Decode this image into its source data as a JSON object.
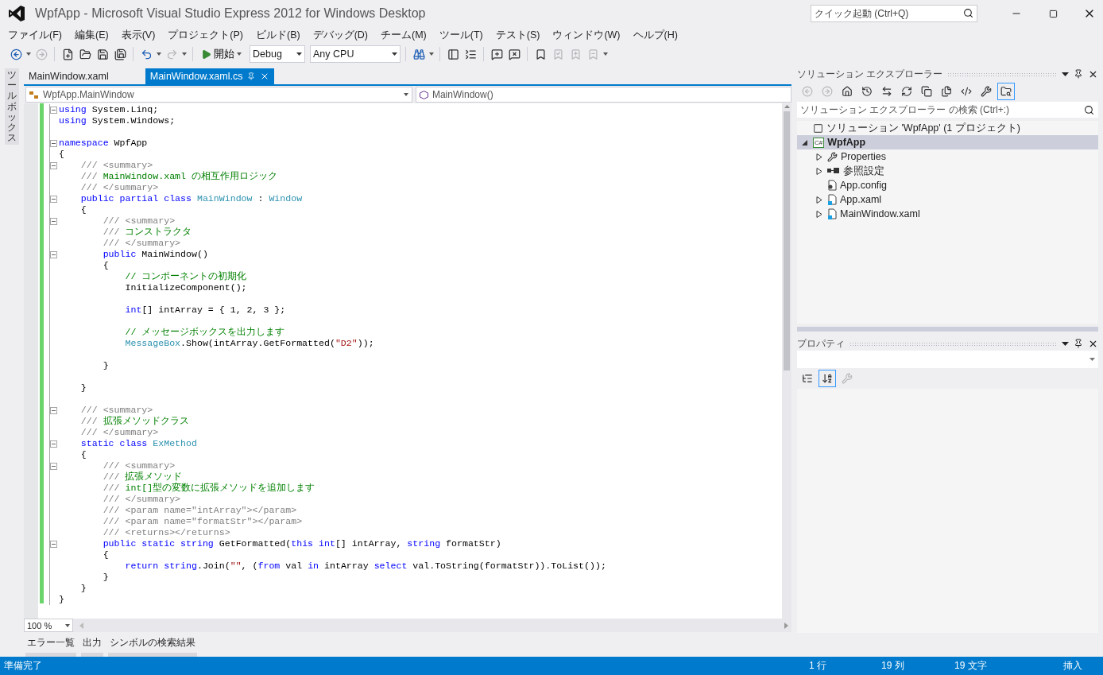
{
  "window": {
    "title": "WpfApp - Microsoft Visual Studio Express 2012 for Windows Desktop",
    "quick_launch": {
      "placeholder": "クイック起動 (Ctrl+Q)"
    }
  },
  "menu": [
    "ファイル(F)",
    "編集(E)",
    "表示(V)",
    "プロジェクト(P)",
    "ビルド(B)",
    "デバッグ(D)",
    "チーム(M)",
    "ツール(T)",
    "テスト(S)",
    "ウィンドウ(W)",
    "ヘルプ(H)"
  ],
  "toolbar": [
    {
      "kind": "icon",
      "disabled": false
    },
    {
      "kind": "caret"
    },
    {
      "kind": "icon",
      "disabled": true
    },
    {
      "kind": "separator"
    },
    {
      "kind": "icon",
      "disabled": false
    },
    {
      "kind": "icon",
      "disabled": false
    },
    {
      "kind": "icon",
      "disabled": false
    },
    {
      "kind": "icon",
      "disabled": false
    },
    {
      "kind": "separator"
    },
    {
      "kind": "icon",
      "disabled": false
    },
    {
      "kind": "caret"
    },
    {
      "kind": "icon",
      "disabled": true
    },
    {
      "kind": "caret"
    },
    {
      "kind": "separator"
    },
    {
      "kind": "button",
      "label": "開始"
    },
    {
      "kind": "dropdown",
      "value": "Debug"
    },
    {
      "kind": "dropdown",
      "value": "Any CPU"
    },
    {
      "kind": "separator"
    },
    {
      "kind": "icon",
      "disabled": false
    },
    {
      "kind": "caret"
    },
    {
      "kind": "separator"
    },
    {
      "kind": "icon",
      "disabled": false
    },
    {
      "kind": "icon",
      "disabled": false
    },
    {
      "kind": "separator"
    },
    {
      "kind": "icon",
      "disabled": false
    },
    {
      "kind": "icon",
      "disabled": false
    },
    {
      "kind": "separator"
    },
    {
      "kind": "icon",
      "disabled": false
    },
    {
      "kind": "icon",
      "disabled": true
    },
    {
      "kind": "icon",
      "disabled": true
    },
    {
      "kind": "icon",
      "disabled": true
    },
    {
      "kind": "caret"
    }
  ],
  "side_tab": "ツールボックス",
  "editor": {
    "tabs": [
      {
        "label": "MainWindow.xaml",
        "selected": false
      },
      {
        "label": "MainWindow.xaml.cs",
        "selected": true
      }
    ],
    "nav": {
      "type": "WpfApp.MainWindow",
      "member": "MainWindow()"
    },
    "lines": [
      {
        "fold": true,
        "tokens": [
          {
            "kind": "kw",
            "text": "using"
          },
          {
            "kind": "plain",
            "text": " System.Linq;"
          }
        ]
      },
      {
        "fold": false,
        "tokens": [
          {
            "kind": "kw",
            "text": "using"
          },
          {
            "kind": "plain",
            "text": " System.Windows;"
          }
        ]
      },
      {
        "fold": false
      },
      {
        "fold": true,
        "tokens": [
          {
            "kind": "kw",
            "text": "namespace"
          },
          {
            "kind": "plain",
            "text": " WpfApp"
          }
        ]
      },
      {
        "fold": false,
        "tokens": [
          {
            "kind": "plain",
            "text": "{"
          }
        ]
      },
      {
        "fold": true,
        "tokens": [
          {
            "kind": "doc",
            "text": "    /// <summary>"
          }
        ]
      },
      {
        "fold": false,
        "tokens": [
          {
            "kind": "doc",
            "text": "    ///"
          },
          {
            "kind": "comment",
            "text": " MainWindow.xaml の相互作用ロジック"
          }
        ]
      },
      {
        "fold": false,
        "tokens": [
          {
            "kind": "doc",
            "text": "    /// </summary>"
          }
        ]
      },
      {
        "fold": true,
        "tokens": [
          {
            "kind": "kw",
            "text": "    public partial class"
          },
          {
            "kind": "type",
            "text": " MainWindow"
          },
          {
            "kind": "plain",
            "text": " : "
          },
          {
            "kind": "type",
            "text": "Window"
          }
        ]
      },
      {
        "fold": false,
        "tokens": [
          {
            "kind": "plain",
            "text": "    {"
          }
        ]
      },
      {
        "fold": true,
        "tokens": [
          {
            "kind": "doc",
            "text": "        /// <summary>"
          }
        ]
      },
      {
        "fold": false,
        "tokens": [
          {
            "kind": "doc",
            "text": "        ///"
          },
          {
            "kind": "comment",
            "text": " コンストラクタ"
          }
        ]
      },
      {
        "fold": false,
        "tokens": [
          {
            "kind": "doc",
            "text": "        /// </summary>"
          }
        ]
      },
      {
        "fold": true,
        "tokens": [
          {
            "kind": "kw",
            "text": "        public"
          },
          {
            "kind": "plain",
            "text": " MainWindow()"
          }
        ]
      },
      {
        "fold": false,
        "tokens": [
          {
            "kind": "plain",
            "text": "        {"
          }
        ]
      },
      {
        "fold": false,
        "tokens": [
          {
            "kind": "comment",
            "text": "            // コンポーネントの初期化"
          }
        ]
      },
      {
        "fold": false,
        "tokens": [
          {
            "kind": "plain",
            "text": "            InitializeComponent();"
          }
        ]
      },
      {
        "fold": false
      },
      {
        "fold": false,
        "tokens": [
          {
            "kind": "kw",
            "text": "            int"
          },
          {
            "kind": "plain",
            "text": "[] intArray = { 1, 2, 3 };"
          }
        ]
      },
      {
        "fold": false
      },
      {
        "fold": false,
        "tokens": [
          {
            "kind": "comment",
            "text": "            // メッセージボックスを出力します"
          }
        ]
      },
      {
        "fold": false,
        "tokens": [
          {
            "kind": "type",
            "text": "            MessageBox"
          },
          {
            "kind": "plain",
            "text": ".Show(intArray.GetFormatted("
          },
          {
            "kind": "str",
            "text": "\"D2\""
          },
          {
            "kind": "plain",
            "text": "));"
          }
        ]
      },
      {
        "fold": false
      },
      {
        "fold": false,
        "tokens": [
          {
            "kind": "plain",
            "text": "        }"
          }
        ]
      },
      {
        "fold": false
      },
      {
        "fold": false,
        "tokens": [
          {
            "kind": "plain",
            "text": "    }"
          }
        ]
      },
      {
        "fold": false
      },
      {
        "fold": true,
        "tokens": [
          {
            "kind": "doc",
            "text": "    /// <summary>"
          }
        ]
      },
      {
        "fold": false,
        "tokens": [
          {
            "kind": "doc",
            "text": "    ///"
          },
          {
            "kind": "comment",
            "text": " 拡張メソッドクラス"
          }
        ]
      },
      {
        "fold": false,
        "tokens": [
          {
            "kind": "doc",
            "text": "    /// </summary>"
          }
        ]
      },
      {
        "fold": true,
        "tokens": [
          {
            "kind": "kw",
            "text": "    static class"
          },
          {
            "kind": "type",
            "text": " ExMethod"
          }
        ]
      },
      {
        "fold": false,
        "tokens": [
          {
            "kind": "plain",
            "text": "    {"
          }
        ]
      },
      {
        "fold": true,
        "tokens": [
          {
            "kind": "doc",
            "text": "        /// <summary>"
          }
        ]
      },
      {
        "fold": false,
        "tokens": [
          {
            "kind": "doc",
            "text": "        ///"
          },
          {
            "kind": "comment",
            "text": " 拡張メソッド"
          }
        ]
      },
      {
        "fold": false,
        "tokens": [
          {
            "kind": "doc",
            "text": "        ///"
          },
          {
            "kind": "comment",
            "text": " int[]型の変数に拡張メソッドを追加します"
          }
        ]
      },
      {
        "fold": false,
        "tokens": [
          {
            "kind": "doc",
            "text": "        /// </summary>"
          }
        ]
      },
      {
        "fold": false,
        "tokens": [
          {
            "kind": "doc",
            "text": "        /// <param name=\"intArray\"></param>"
          }
        ]
      },
      {
        "fold": false,
        "tokens": [
          {
            "kind": "doc",
            "text": "        /// <param name=\"formatStr\"></param>"
          }
        ]
      },
      {
        "fold": false,
        "tokens": [
          {
            "kind": "doc",
            "text": "        /// <returns></returns>"
          }
        ]
      },
      {
        "fold": true,
        "tokens": [
          {
            "kind": "kw",
            "text": "        public static string"
          },
          {
            "kind": "plain",
            "text": " GetFormatted("
          },
          {
            "kind": "kw",
            "text": "this int"
          },
          {
            "kind": "plain",
            "text": "[] intArray, "
          },
          {
            "kind": "kw",
            "text": "string"
          },
          {
            "kind": "plain",
            "text": " formatStr)"
          }
        ]
      },
      {
        "fold": false,
        "tokens": [
          {
            "kind": "plain",
            "text": "        {"
          }
        ]
      },
      {
        "fold": false,
        "tokens": [
          {
            "kind": "kw",
            "text": "            return string"
          },
          {
            "kind": "plain",
            "text": ".Join("
          },
          {
            "kind": "str",
            "text": "\"\""
          },
          {
            "kind": "plain",
            "text": ", ("
          },
          {
            "kind": "kw",
            "text": "from"
          },
          {
            "kind": "plain",
            "text": " val "
          },
          {
            "kind": "kw",
            "text": "in"
          },
          {
            "kind": "plain",
            "text": " intArray "
          },
          {
            "kind": "kw",
            "text": "select"
          },
          {
            "kind": "plain",
            "text": " val.ToString(formatStr)).ToList());"
          }
        ]
      },
      {
        "fold": false,
        "tokens": [
          {
            "kind": "plain",
            "text": "        }"
          }
        ]
      },
      {
        "fold": false,
        "tokens": [
          {
            "kind": "plain",
            "text": "    }"
          }
        ]
      },
      {
        "fold": false,
        "tokens": [
          {
            "kind": "plain",
            "text": "}"
          }
        ]
      }
    ],
    "zoom": "100 %"
  },
  "bottom_tabs": [
    "エラー一覧",
    "出力",
    "シンボルの検索結果"
  ],
  "solution_explorer": {
    "title": "ソリューション エクスプローラー",
    "toolbar": [
      {
        "selected": false,
        "disabled": true
      },
      {
        "selected": false,
        "disabled": true
      },
      {
        "selected": false,
        "disabled": false
      },
      {
        "selected": false,
        "disabled": false
      },
      {
        "selected": false,
        "disabled": false
      },
      {
        "selected": false,
        "disabled": false
      },
      {
        "selected": false,
        "disabled": false
      },
      {
        "selected": false,
        "disabled": false
      },
      {
        "selected": false,
        "disabled": false
      },
      {
        "selected": false,
        "disabled": false
      },
      {
        "selected": true,
        "disabled": false
      }
    ],
    "search": {
      "placeholder": "ソリューション エクスプローラー の検索 (Ctrl+:)"
    },
    "tree": [
      {
        "kind": "solution",
        "label": "ソリューション 'WpfApp' (1 プロジェクト)",
        "selected": false,
        "children": [
          {
            "kind": "project",
            "icon_text": "C#",
            "label": "WpfApp",
            "selected": true,
            "expanded": true,
            "children": [
              {
                "kind": "properties",
                "label": "Properties",
                "selected": false,
                "expanded": false
              },
              {
                "kind": "references",
                "label": "参照設定",
                "selected": false,
                "expanded": false
              },
              {
                "kind": "config",
                "label": "App.config",
                "selected": false
              },
              {
                "kind": "xaml",
                "label": "App.xaml",
                "selected": false,
                "expanded": false
              },
              {
                "kind": "xaml",
                "label": "MainWindow.xaml",
                "selected": false,
                "expanded": false
              }
            ]
          }
        ]
      }
    ]
  },
  "properties": {
    "title": "プロパティ",
    "toolbar": [
      {
        "selected": false,
        "disabled": false
      },
      {
        "selected": true,
        "disabled": false
      },
      {
        "selected": false,
        "disabled": true
      }
    ]
  },
  "status_bar": {
    "message": "準備完了",
    "line": "1 行",
    "column": "19 列",
    "char": "19 文字",
    "mode": "挿入"
  }
}
